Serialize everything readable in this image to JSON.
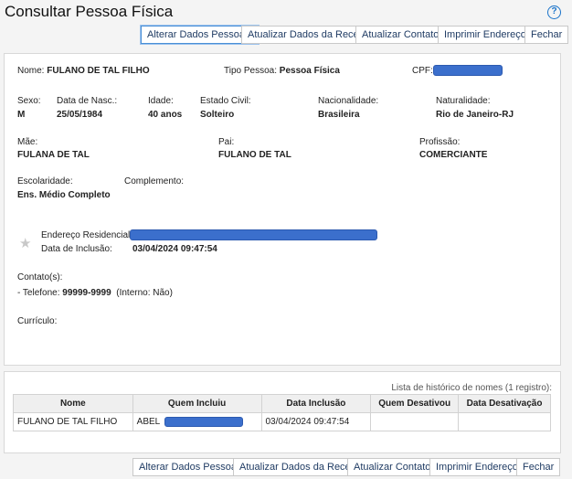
{
  "page": {
    "title": "Consultar Pessoa Física"
  },
  "toolbar": {
    "alterar": "Alterar Dados Pessoais",
    "atualizar_receita": "Atualizar Dados da Receita",
    "atualizar_contatos": "Atualizar Contatos",
    "imprimir": "Imprimir Endereços",
    "fechar": "Fechar"
  },
  "person": {
    "nome_label": "Nome:",
    "nome": "FULANO DE TAL FILHO",
    "tipo_label": "Tipo Pessoa:",
    "tipo": "Pessoa Física",
    "cpf_label": "CPF:",
    "sexo_label": "Sexo:",
    "sexo": "M",
    "nasc_label": "Data de Nasc.:",
    "nasc": "25/05/1984",
    "idade_label": "Idade:",
    "idade": "40 anos",
    "civil_label": "Estado Civil:",
    "civil": "Solteiro",
    "nac_label": "Nacionalidade:",
    "nac": "Brasileira",
    "natural_label": "Naturalidade:",
    "natural": "Rio de Janeiro-RJ",
    "mae_label": "Mãe:",
    "mae": "FULANA DE TAL",
    "pai_label": "Pai:",
    "pai": "FULANO DE TAL",
    "prof_label": "Profissão:",
    "prof": "COMERCIANTE",
    "esc_label": "Escolaridade:",
    "esc": "Ens. Médio Completo",
    "compl_label": "Complemento:",
    "end_label": "Endereço Residencial:",
    "incl_label": "Data de Inclusão:",
    "incl": "03/04/2024 09:47:54",
    "contatos_label": "Contato(s):",
    "tel_prefix": "- Telefone:",
    "tel": "99999-9999",
    "tel_suffix": "(Interno: Não)",
    "curriculo_label": "Currículo:"
  },
  "history": {
    "hint": "Lista de histórico de nomes (1 registro):",
    "headers": [
      "Nome",
      "Quem Incluiu",
      "Data Inclusão",
      "Quem Desativou",
      "Data Desativação"
    ],
    "rows": [
      {
        "nome": "FULANO DE TAL FILHO",
        "quem": "ABEL",
        "data": "03/04/2024 09:47:54",
        "desativou": "",
        "data_desat": ""
      }
    ]
  },
  "colors": {
    "redaction": "#3b6fcc",
    "link": "#1f3b63",
    "help": "#1a73c9"
  }
}
